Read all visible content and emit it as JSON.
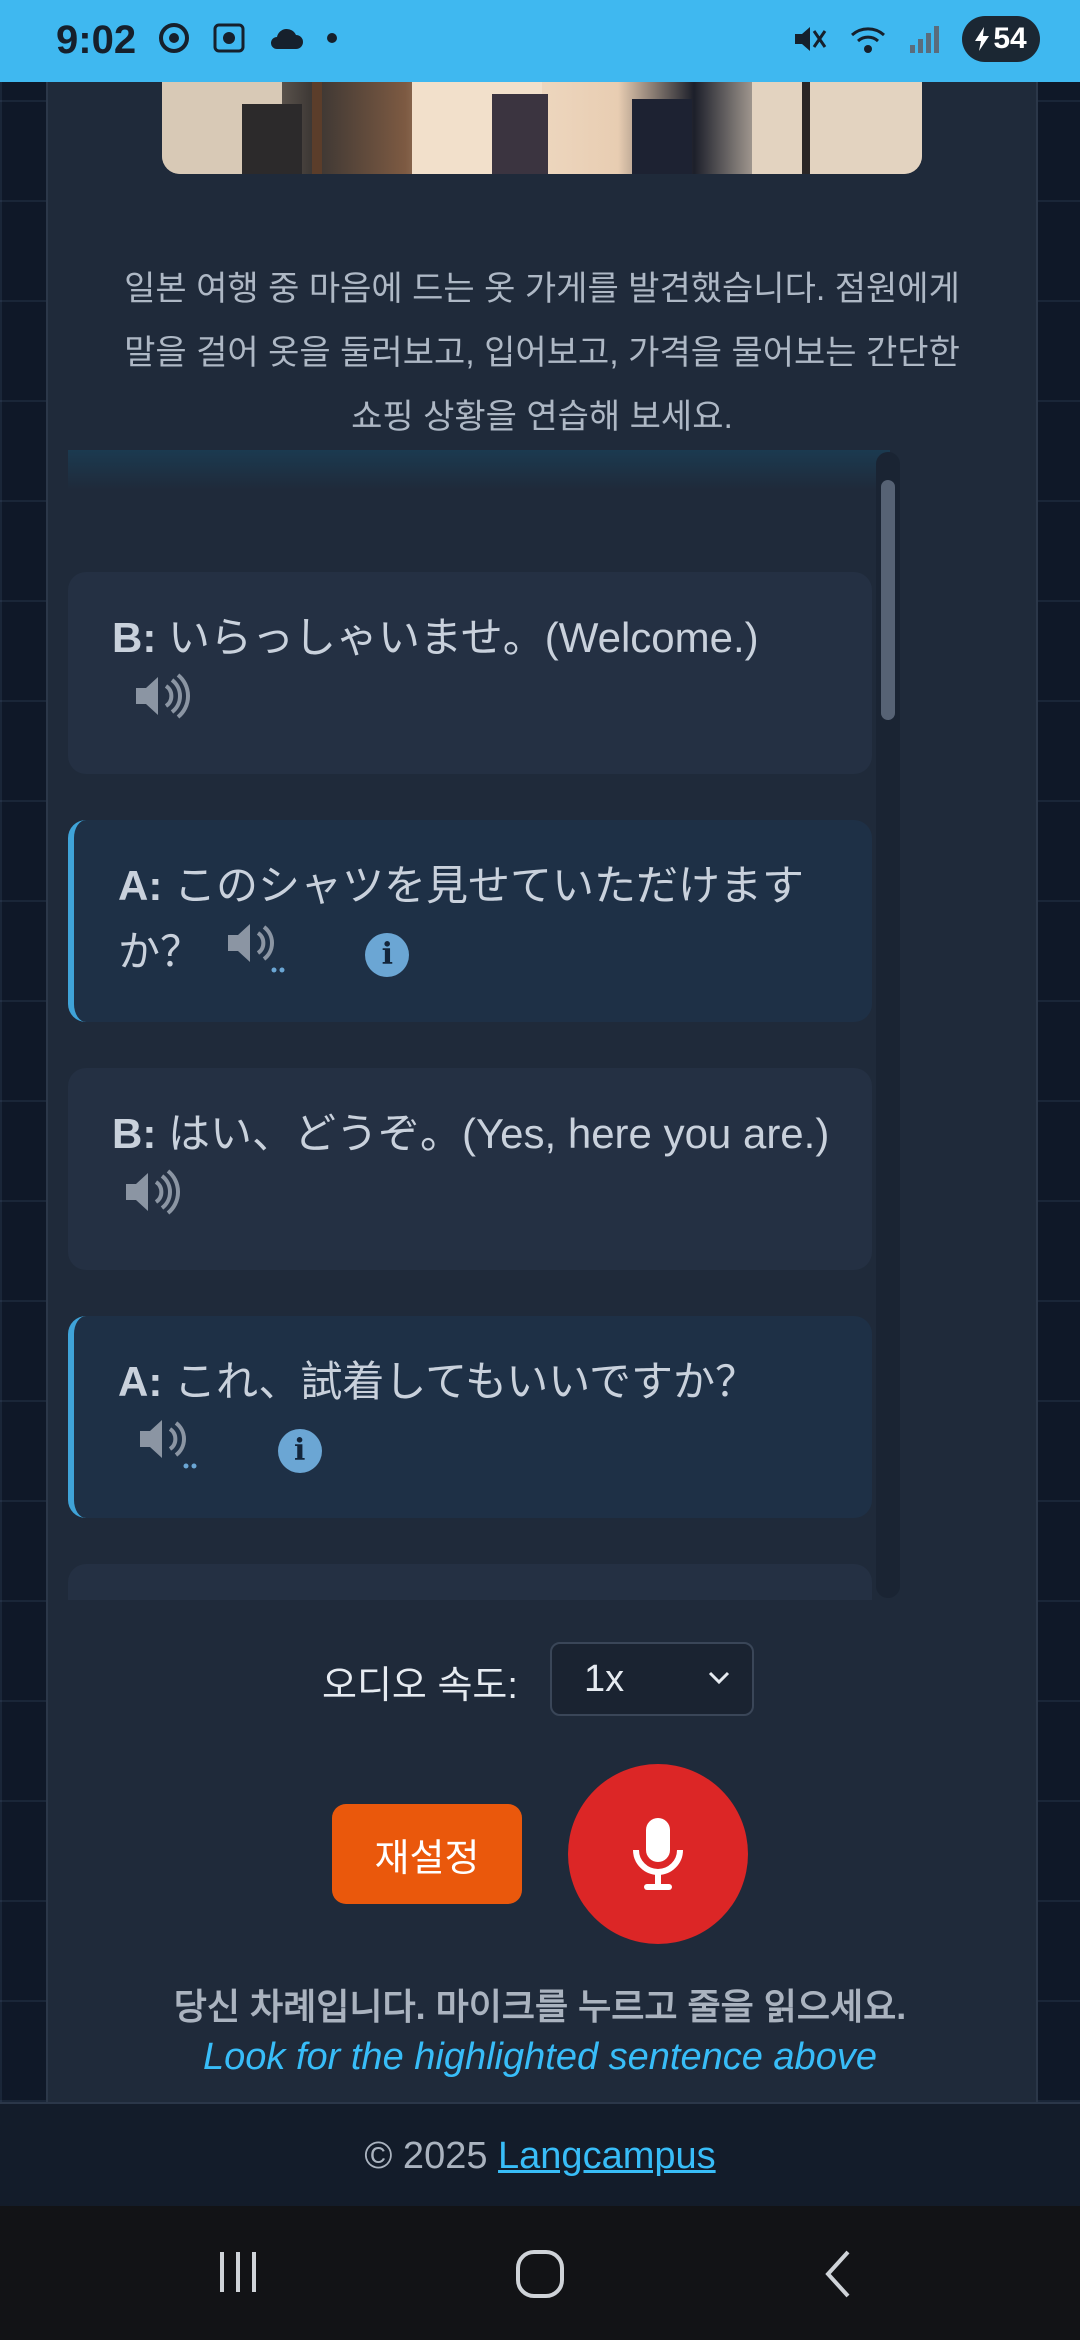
{
  "status_bar": {
    "time": "9:02",
    "battery_level": "54",
    "icons_left": [
      "chrome-icon",
      "screenshot-icon",
      "cloud-icon",
      "dot-icon"
    ],
    "icons_right": [
      "mute-icon",
      "wifi-icon",
      "signal-icon",
      "battery-icon"
    ]
  },
  "intro": "일본 여행 중 마음에 드는 옷 가게를 발견했습니다. 점원에게 말을 걸어 옷을 둘러보고, 입어보고, 가격을 물어보는 간단한 쇼핑 상황을 연습해 보세요.",
  "dialogue": [
    {
      "speaker": "B:",
      "text": "いらっしゃいませ。(Welcome.)",
      "active": false
    },
    {
      "speaker": "A:",
      "text": "このシャツを見せていただけますか？",
      "active": true
    },
    {
      "speaker": "B:",
      "text": "はい、どうぞ。(Yes, here you are.)",
      "active": false
    },
    {
      "speaker": "A:",
      "text": "これ、試着してもいいですか？",
      "active": true
    }
  ],
  "audio_speed": {
    "label": "오디오 속도:",
    "value": "1x"
  },
  "buttons": {
    "reset": "재설정",
    "mic_icon": "microphone-icon"
  },
  "turn_message": "당신 차례입니다. 마이크를 누르고 줄을 읽으세요.",
  "hint": "Look for the highlighted sentence above",
  "footer": {
    "copyright": "© 2025",
    "link": "Langcampus"
  },
  "colors": {
    "status_bar": "#3fb8f0",
    "accent_blue": "#38bdf8",
    "reset_orange": "#ea580c",
    "mic_red": "#dc2626",
    "card_bg": "#1f2a3a"
  }
}
